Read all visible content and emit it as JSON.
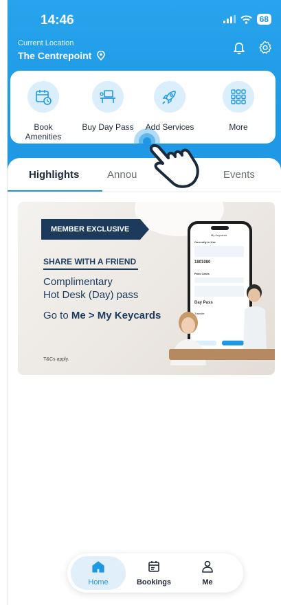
{
  "status_bar": {
    "time": "14:46",
    "battery": "68"
  },
  "location": {
    "label": "Current Location",
    "name": "The Centrepoint"
  },
  "quick_actions": [
    {
      "label": "Book\nAmenities",
      "icon": "calendar-clock-icon"
    },
    {
      "label": "Buy Day Pass",
      "icon": "desk-icon"
    },
    {
      "label": "Add Services",
      "icon": "rocket-icon"
    },
    {
      "label": "More",
      "icon": "grid-icon"
    }
  ],
  "tabs": [
    "Highlights",
    "Annou",
    "Events"
  ],
  "banner": {
    "ribbon": "MEMBER EXCLUSIVE",
    "share": "SHARE WITH A FRIEND",
    "complimentary": "Complimentary\nHot Desk (Day) pass",
    "goto_prefix": "Go to ",
    "goto_path": "Me > My Keycards",
    "tandc": "T&Cs apply.",
    "phone": {
      "title": "My Keycards",
      "currently": "Currently in Use",
      "number": "1801080",
      "pass_cards": "Pass Cards",
      "day_pass": "Day Pass",
      "transfer": "Transfer"
    }
  },
  "bottom_nav": [
    {
      "label": "Home",
      "icon": "home-icon"
    },
    {
      "label": "Bookings",
      "icon": "calendar-icon"
    },
    {
      "label": "Me",
      "icon": "person-icon"
    }
  ],
  "colors": {
    "accent": "#1f98e4",
    "navy": "#1b3a5c",
    "icon_bg": "#dbeefb"
  }
}
